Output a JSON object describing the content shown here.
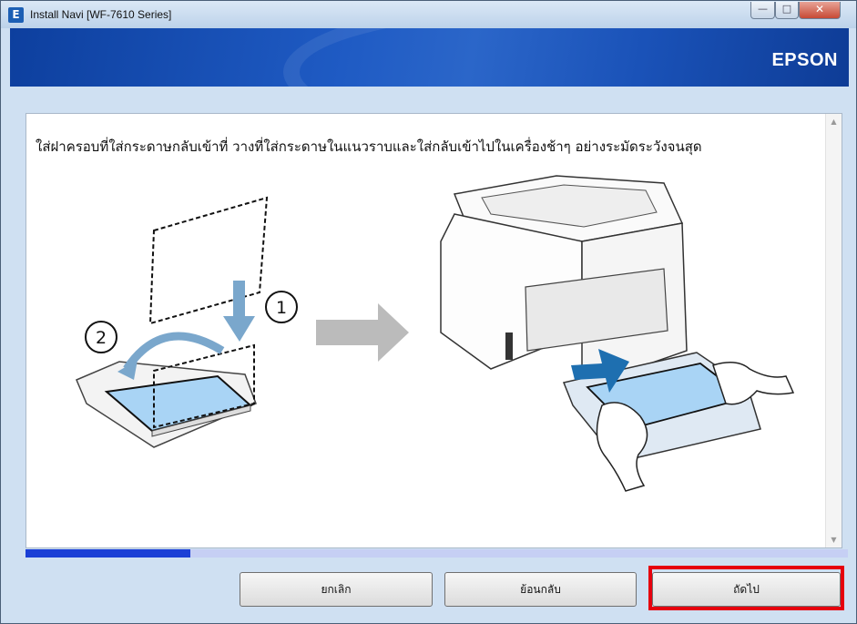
{
  "window": {
    "title": "Install Navi [WF-7610 Series]",
    "app_icon_letter": "E",
    "controls": {
      "minimize": "—",
      "maximize": "□",
      "close": "✕"
    }
  },
  "banner": {
    "brand": "EPSON"
  },
  "content": {
    "instruction": "ใส่ฝาครอบที่ใส่กระดาษกลับเข้าที่ วางที่ใส่กระดาษในแนวราบและใส่กลับเข้าไปในเครื่องช้าๆ อย่างระมัดระวังจนสุด",
    "step_markers": [
      "①",
      "②"
    ]
  },
  "progress": {
    "fraction": 0.2
  },
  "buttons": {
    "cancel": "ยกเลิก",
    "back": "ย้อนกลับ",
    "next": "ถัดไป"
  },
  "colors": {
    "banner": "#1f5bc4",
    "progress_fill": "#1a3fd6",
    "highlight": "#e6000e",
    "paper": "#a9d4f5"
  }
}
